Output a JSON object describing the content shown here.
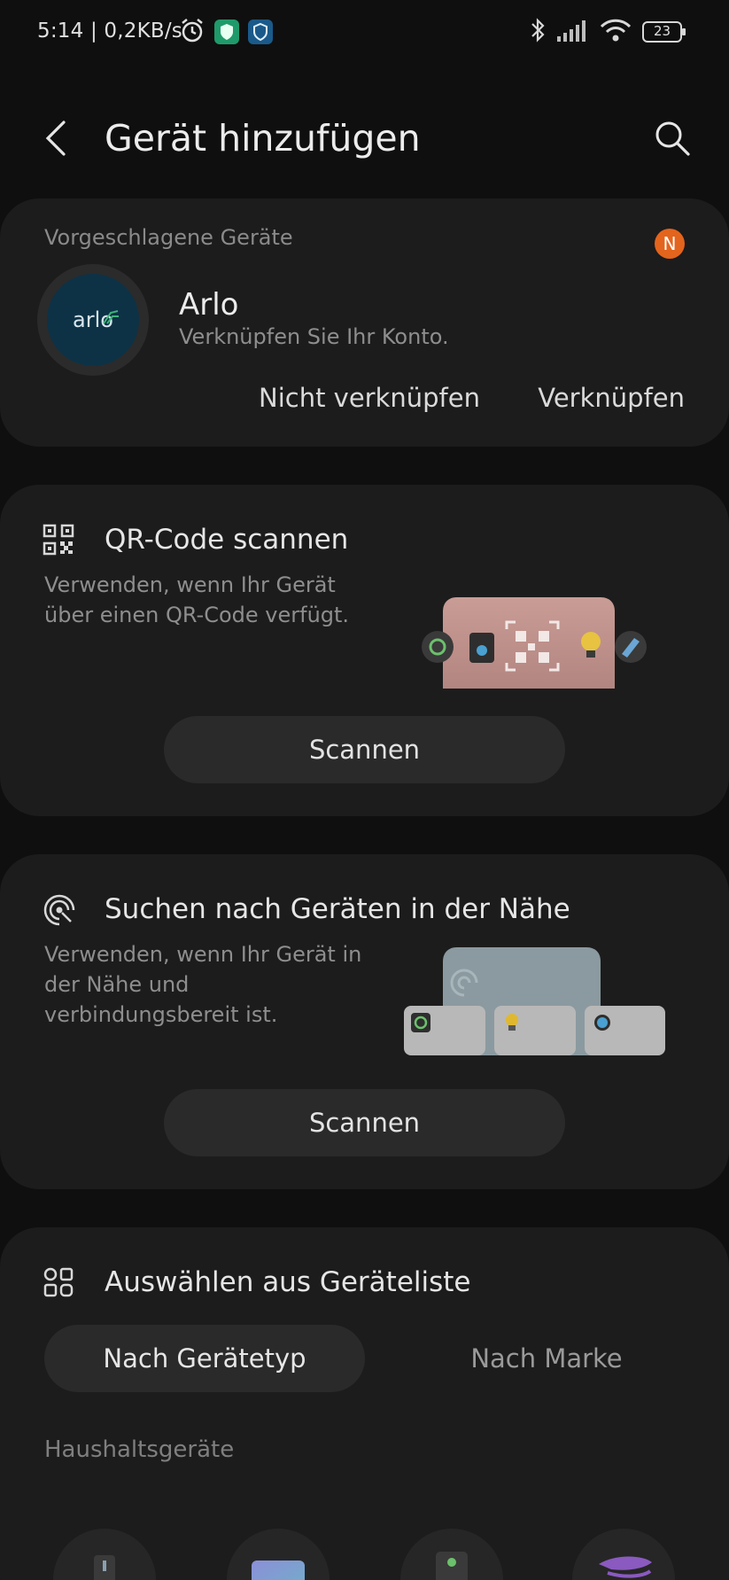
{
  "status_bar": {
    "time_speed": "5:14 | 0,2KB/s",
    "battery": "23"
  },
  "app_bar": {
    "title": "Gerät hinzufügen"
  },
  "suggested": {
    "label": "Vorgeschlagene Geräte",
    "badge": "N",
    "brand_logo_text": "arlo",
    "brand_name": "Arlo",
    "brand_subtitle": "Verknüpfen Sie Ihr Konto.",
    "decline_label": "Nicht verknüpfen",
    "accept_label": "Verknüpfen"
  },
  "qr_card": {
    "title": "QR-Code scannen",
    "description": "Verwenden, wenn Ihr Gerät über einen QR-Code verfügt.",
    "button_label": "Scannen"
  },
  "nearby_card": {
    "title": "Suchen nach Geräten in der Nähe",
    "description": "Verwenden, wenn Ihr Gerät in der Nähe und verbindungsbereit ist.",
    "button_label": "Scannen"
  },
  "device_list": {
    "title": "Auswählen aus Geräteliste",
    "tab_by_type": "Nach Gerätetyp",
    "tab_by_brand": "Nach Marke",
    "section_label": "Haushaltsgeräte"
  },
  "colors": {
    "background": "#0f0f0f",
    "card": "#1c1c1c",
    "button": "#2a2a2a",
    "badge": "#e3641d"
  }
}
